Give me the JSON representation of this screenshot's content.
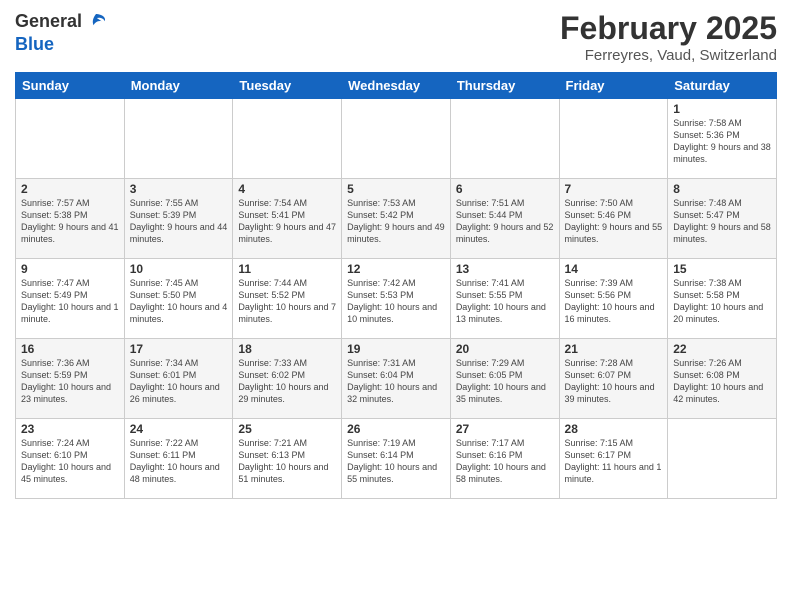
{
  "header": {
    "logo_general": "General",
    "logo_blue": "Blue",
    "title": "February 2025",
    "subtitle": "Ferreyres, Vaud, Switzerland"
  },
  "weekdays": [
    "Sunday",
    "Monday",
    "Tuesday",
    "Wednesday",
    "Thursday",
    "Friday",
    "Saturday"
  ],
  "weeks": [
    [
      {
        "day": "",
        "info": ""
      },
      {
        "day": "",
        "info": ""
      },
      {
        "day": "",
        "info": ""
      },
      {
        "day": "",
        "info": ""
      },
      {
        "day": "",
        "info": ""
      },
      {
        "day": "",
        "info": ""
      },
      {
        "day": "1",
        "info": "Sunrise: 7:58 AM\nSunset: 5:36 PM\nDaylight: 9 hours and 38 minutes."
      }
    ],
    [
      {
        "day": "2",
        "info": "Sunrise: 7:57 AM\nSunset: 5:38 PM\nDaylight: 9 hours and 41 minutes."
      },
      {
        "day": "3",
        "info": "Sunrise: 7:55 AM\nSunset: 5:39 PM\nDaylight: 9 hours and 44 minutes."
      },
      {
        "day": "4",
        "info": "Sunrise: 7:54 AM\nSunset: 5:41 PM\nDaylight: 9 hours and 47 minutes."
      },
      {
        "day": "5",
        "info": "Sunrise: 7:53 AM\nSunset: 5:42 PM\nDaylight: 9 hours and 49 minutes."
      },
      {
        "day": "6",
        "info": "Sunrise: 7:51 AM\nSunset: 5:44 PM\nDaylight: 9 hours and 52 minutes."
      },
      {
        "day": "7",
        "info": "Sunrise: 7:50 AM\nSunset: 5:46 PM\nDaylight: 9 hours and 55 minutes."
      },
      {
        "day": "8",
        "info": "Sunrise: 7:48 AM\nSunset: 5:47 PM\nDaylight: 9 hours and 58 minutes."
      }
    ],
    [
      {
        "day": "9",
        "info": "Sunrise: 7:47 AM\nSunset: 5:49 PM\nDaylight: 10 hours and 1 minute."
      },
      {
        "day": "10",
        "info": "Sunrise: 7:45 AM\nSunset: 5:50 PM\nDaylight: 10 hours and 4 minutes."
      },
      {
        "day": "11",
        "info": "Sunrise: 7:44 AM\nSunset: 5:52 PM\nDaylight: 10 hours and 7 minutes."
      },
      {
        "day": "12",
        "info": "Sunrise: 7:42 AM\nSunset: 5:53 PM\nDaylight: 10 hours and 10 minutes."
      },
      {
        "day": "13",
        "info": "Sunrise: 7:41 AM\nSunset: 5:55 PM\nDaylight: 10 hours and 13 minutes."
      },
      {
        "day": "14",
        "info": "Sunrise: 7:39 AM\nSunset: 5:56 PM\nDaylight: 10 hours and 16 minutes."
      },
      {
        "day": "15",
        "info": "Sunrise: 7:38 AM\nSunset: 5:58 PM\nDaylight: 10 hours and 20 minutes."
      }
    ],
    [
      {
        "day": "16",
        "info": "Sunrise: 7:36 AM\nSunset: 5:59 PM\nDaylight: 10 hours and 23 minutes."
      },
      {
        "day": "17",
        "info": "Sunrise: 7:34 AM\nSunset: 6:01 PM\nDaylight: 10 hours and 26 minutes."
      },
      {
        "day": "18",
        "info": "Sunrise: 7:33 AM\nSunset: 6:02 PM\nDaylight: 10 hours and 29 minutes."
      },
      {
        "day": "19",
        "info": "Sunrise: 7:31 AM\nSunset: 6:04 PM\nDaylight: 10 hours and 32 minutes."
      },
      {
        "day": "20",
        "info": "Sunrise: 7:29 AM\nSunset: 6:05 PM\nDaylight: 10 hours and 35 minutes."
      },
      {
        "day": "21",
        "info": "Sunrise: 7:28 AM\nSunset: 6:07 PM\nDaylight: 10 hours and 39 minutes."
      },
      {
        "day": "22",
        "info": "Sunrise: 7:26 AM\nSunset: 6:08 PM\nDaylight: 10 hours and 42 minutes."
      }
    ],
    [
      {
        "day": "23",
        "info": "Sunrise: 7:24 AM\nSunset: 6:10 PM\nDaylight: 10 hours and 45 minutes."
      },
      {
        "day": "24",
        "info": "Sunrise: 7:22 AM\nSunset: 6:11 PM\nDaylight: 10 hours and 48 minutes."
      },
      {
        "day": "25",
        "info": "Sunrise: 7:21 AM\nSunset: 6:13 PM\nDaylight: 10 hours and 51 minutes."
      },
      {
        "day": "26",
        "info": "Sunrise: 7:19 AM\nSunset: 6:14 PM\nDaylight: 10 hours and 55 minutes."
      },
      {
        "day": "27",
        "info": "Sunrise: 7:17 AM\nSunset: 6:16 PM\nDaylight: 10 hours and 58 minutes."
      },
      {
        "day": "28",
        "info": "Sunrise: 7:15 AM\nSunset: 6:17 PM\nDaylight: 11 hours and 1 minute."
      },
      {
        "day": "",
        "info": ""
      }
    ]
  ]
}
